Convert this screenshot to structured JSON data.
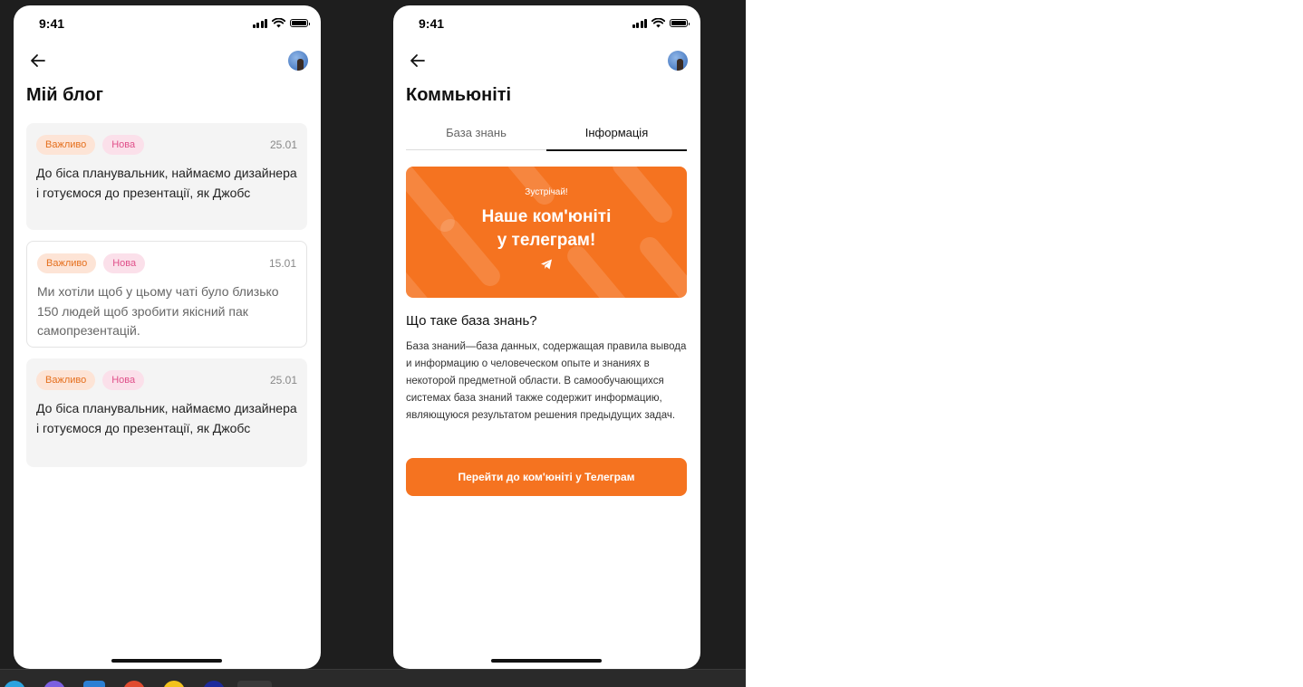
{
  "left_phone": {
    "status_time": "9:41",
    "title": "Мій блог",
    "posts": [
      {
        "tags": [
          "Важливо",
          "Нова"
        ],
        "date": "25.01",
        "text": "До біса планувальник, наймаємо дизайнера і готуємося до презентації, як Джобс"
      },
      {
        "tags": [
          "Важливо",
          "Нова"
        ],
        "date": "15.01",
        "text": "Ми хотіли щоб у цьому чаті було близько 150 людей щоб зробити якісний пак самопрезентацій."
      },
      {
        "tags": [
          "Важливо",
          "Нова"
        ],
        "date": "25.01",
        "text": "До біса планувальник, наймаємо дизайнера і готуємося до презентації, як Джобс"
      }
    ]
  },
  "right_phone": {
    "status_time": "9:41",
    "title": "Коммьюніті",
    "tabs": [
      {
        "label": "База знань",
        "active": false
      },
      {
        "label": "Інформація",
        "active": true
      }
    ],
    "banner": {
      "pretitle": "Зустрічай!",
      "title_line1": "Наше ком'юніті",
      "title_line2": "у телеграм!",
      "icon": "telegram-plane-icon"
    },
    "section_title": "Що таке база знань?",
    "paragraph": "База знаний—база данных, содержащая правила вывода и информацию о человеческом опыте и знаниях в некоторой предметной области. В самообучающихся системах база знаний также содержит информацию, являющуюся результатом решения предыдущих задач.",
    "cta_label": "Перейти до ком'юніті у Телеграм"
  },
  "colors": {
    "accent": "#f57320",
    "tag_important_bg": "#fde4d6",
    "tag_important_text": "#e5701e",
    "tag_new_bg": "#fbe0ea",
    "tag_new_text": "#e0508a",
    "canvas": "#1e1e1e"
  }
}
